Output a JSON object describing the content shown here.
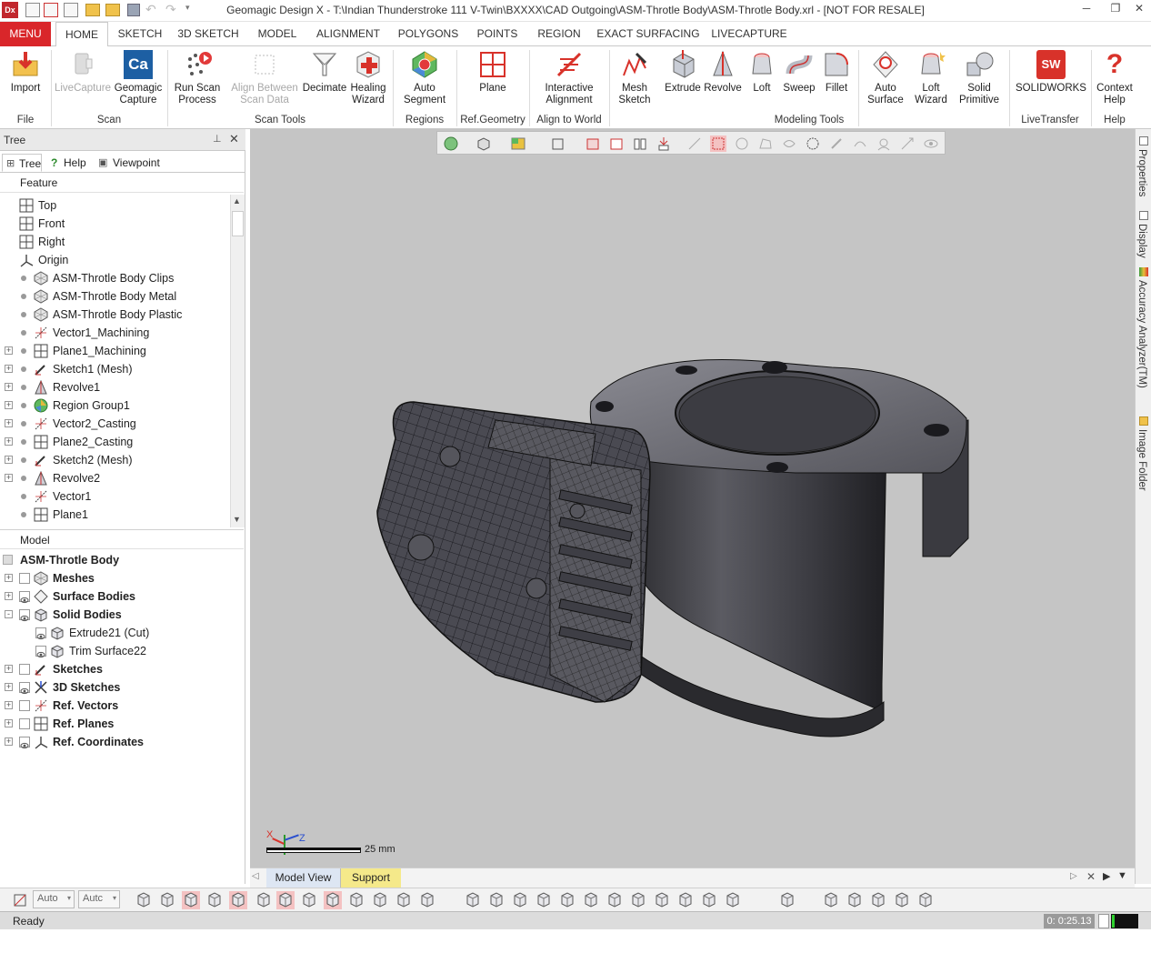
{
  "window": {
    "title": "Geomagic Design X - T:\\Indian Thunderstroke 111 V-Twin\\BXXXX\\CAD Outgoing\\ASM-Throtle Body\\ASM-Throtle Body.xrl - [NOT FOR RESALE]",
    "app_badge": "Dx"
  },
  "tabs": [
    "MENU",
    "HOME",
    "SKETCH",
    "3D SKETCH",
    "MODEL",
    "ALIGNMENT",
    "POLYGONS",
    "POINTS",
    "REGION",
    "EXACT SURFACING",
    "LIVECAPTURE"
  ],
  "ribbon": {
    "buttons": {
      "import": "Import",
      "livecapture": "LiveCapture",
      "geomagic_capture": "Geomagic\nCapture",
      "run_scan": "Run Scan\nProcess",
      "align_between": "Align Between\nScan Data",
      "decimate": "Decimate",
      "healing": "Healing\nWizard",
      "auto_segment": "Auto\nSegment",
      "plane": "Plane",
      "interactive_alignment": "Interactive\nAlignment",
      "mesh_sketch": "Mesh\nSketch",
      "extrude": "Extrude",
      "revolve": "Revolve",
      "loft": "Loft",
      "sweep": "Sweep",
      "fillet": "Fillet",
      "auto_surface": "Auto\nSurface",
      "loft_wizard": "Loft\nWizard",
      "solid_primitive": "Solid\nPrimitive",
      "solidworks": "SOLIDWORKS",
      "context_help": "Context\nHelp"
    },
    "groups": {
      "file": "File",
      "scan": "Scan",
      "scan_tools": "Scan Tools",
      "regions": "Regions",
      "ref_geometry": "Ref.Geometry",
      "align_to_world": "Align to World",
      "modeling_tools": "Modeling Tools",
      "livetransfer": "LiveTransfer",
      "help": "Help"
    },
    "ca_icon_text": "Ca",
    "sw_icon_text": "SW"
  },
  "panel": {
    "title": "Tree",
    "tabs": [
      "Tree",
      "Help",
      "Viewpoint"
    ],
    "feature_header": "Feature",
    "features": [
      {
        "label": "Top",
        "icon": "plane-icon",
        "dot": false,
        "expand": false
      },
      {
        "label": "Front",
        "icon": "plane-icon",
        "dot": false,
        "expand": false
      },
      {
        "label": "Right",
        "icon": "plane-icon",
        "dot": false,
        "expand": false
      },
      {
        "label": "Origin",
        "icon": "origin-icon",
        "dot": false,
        "expand": false
      },
      {
        "label": "ASM-Throtle Body Clips",
        "icon": "mesh-icon",
        "dot": true,
        "expand": false
      },
      {
        "label": "ASM-Throtle Body Metal",
        "icon": "mesh-icon",
        "dot": true,
        "expand": false
      },
      {
        "label": "ASM-Throtle Body Plastic",
        "icon": "mesh-icon",
        "dot": true,
        "expand": false
      },
      {
        "label": "Vector1_Machining",
        "icon": "vector-icon",
        "dot": true,
        "expand": false
      },
      {
        "label": "Plane1_Machining",
        "icon": "plane-icon",
        "dot": true,
        "expand": true
      },
      {
        "label": "Sketch1 (Mesh)",
        "icon": "sketch-icon",
        "dot": true,
        "expand": true
      },
      {
        "label": "Revolve1",
        "icon": "revolve-icon",
        "dot": true,
        "expand": true
      },
      {
        "label": "Region Group1",
        "icon": "region-icon",
        "dot": true,
        "expand": true
      },
      {
        "label": "Vector2_Casting",
        "icon": "vector-icon",
        "dot": true,
        "expand": true
      },
      {
        "label": "Plane2_Casting",
        "icon": "plane-icon",
        "dot": true,
        "expand": true
      },
      {
        "label": "Sketch2 (Mesh)",
        "icon": "sketch-icon",
        "dot": true,
        "expand": true
      },
      {
        "label": "Revolve2",
        "icon": "revolve-icon",
        "dot": true,
        "expand": true
      },
      {
        "label": "Vector1",
        "icon": "vector-icon",
        "dot": true,
        "expand": false
      },
      {
        "label": "Plane1",
        "icon": "plane-icon",
        "dot": true,
        "expand": false
      }
    ],
    "model_header": "Model",
    "model_root": "ASM-Throtle Body",
    "model_items": [
      {
        "label": "Meshes",
        "icon": "mesh-icon",
        "level": 0,
        "expand": "+",
        "eye": false,
        "bold": true
      },
      {
        "label": "Surface Bodies",
        "icon": "surface-icon",
        "level": 0,
        "expand": "+",
        "eye": true,
        "bold": true
      },
      {
        "label": "Solid Bodies",
        "icon": "solid-icon",
        "level": 0,
        "expand": "-",
        "eye": true,
        "bold": true
      },
      {
        "label": "Extrude21 (Cut)",
        "icon": "solid-icon",
        "level": 1,
        "expand": "",
        "eye": true,
        "bold": false
      },
      {
        "label": "Trim Surface22",
        "icon": "solid-icon",
        "level": 1,
        "expand": "",
        "eye": true,
        "bold": false
      },
      {
        "label": "Sketches",
        "icon": "sketch-icon",
        "level": 0,
        "expand": "+",
        "eye": false,
        "bold": true
      },
      {
        "label": "3D Sketches",
        "icon": "sketch3d-icon",
        "level": 0,
        "expand": "+",
        "eye": true,
        "bold": true
      },
      {
        "label": "Ref. Vectors",
        "icon": "vector-icon",
        "level": 0,
        "expand": "+",
        "eye": false,
        "bold": true
      },
      {
        "label": "Ref. Planes",
        "icon": "plane-icon",
        "level": 0,
        "expand": "+",
        "eye": false,
        "bold": true
      },
      {
        "label": "Ref. Coordinates",
        "icon": "origin-icon",
        "level": 0,
        "expand": "+",
        "eye": true,
        "bold": true
      }
    ]
  },
  "viewport": {
    "scale_label": "25 mm",
    "axis_x": "X",
    "axis_z": "Z"
  },
  "right_panels": [
    "Properties",
    "Display",
    "Accuracy Analyzer(TM)",
    "Image Folder"
  ],
  "view_tabs": [
    "Model View",
    "Support"
  ],
  "bottom": {
    "select1": "Auto",
    "select2": "Autc"
  },
  "status": {
    "text": "Ready",
    "time": "0: 0:25.13"
  },
  "colors": {
    "accent": "#d9262a",
    "viewport_bg": "#c5c5c5",
    "support_tab": "#f5e98a"
  }
}
